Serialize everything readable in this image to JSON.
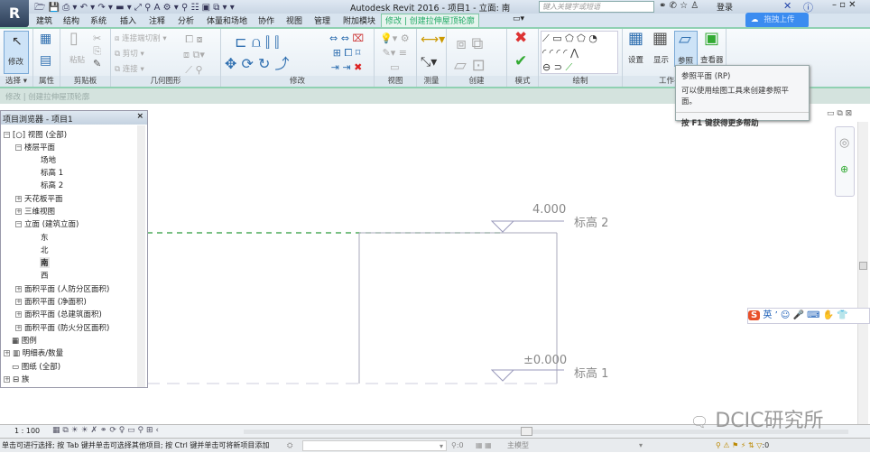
{
  "app": {
    "title": "Autodesk Revit 2016 -    项目1 - 立面: 南",
    "logo": "R",
    "search_placeholder": "键入关键字或短语",
    "login": "登录",
    "upload": "拖拽上传"
  },
  "tabs": [
    "建筑",
    "结构",
    "系统",
    "插入",
    "注释",
    "分析",
    "体量和场地",
    "协作",
    "视图",
    "管理",
    "附加模块",
    "修改 | 创建拉伸屋顶轮廓"
  ],
  "ribbon": {
    "modify_btn": "修改",
    "paste": "粘贴",
    "geometry": {
      "join_cut": "连接端切割",
      "cut": "剪切",
      "join": "连接"
    },
    "workplane": {
      "set": "设置",
      "show": "显示",
      "ref": "参照",
      "viewer": "查看器"
    },
    "panels": {
      "select": "选择",
      "properties": "属性",
      "clipboard": "剪贴板",
      "geometry": "几何图形",
      "modify": "修改",
      "view": "视图",
      "measure": "测量",
      "create": "创建",
      "mode": "模式",
      "draw": "绘制",
      "workplane": "工作平面"
    }
  },
  "context_bar": "修改 | 创建拉伸屋顶轮廓",
  "tooltip": {
    "title": "参照平面 (RP)",
    "desc": "可以使用绘图工具来创建参照平面。",
    "help": "按 F1 键获得更多帮助"
  },
  "browser": {
    "title": "项目浏览器 - 项目1",
    "items": [
      "视图 (全部)",
      "楼层平面",
      "场地",
      "标高 1",
      "标高 2",
      "天花板平面",
      "三维视图",
      "立面 (建筑立面)",
      "东",
      "北",
      "南",
      "西",
      "面积平面 (人防分区面积)",
      "面积平面 (净面积)",
      "面积平面 (总建筑面积)",
      "面积平面 (防火分区面积)",
      "图例",
      "明细表/数量",
      "图纸 (全部)",
      "族"
    ]
  },
  "drawing": {
    "level2_value": "4.000",
    "level2_name": "标高 2",
    "level1_value": "±0.000",
    "level1_name": "标高 1",
    "sketch_color": "#2a9a3a"
  },
  "view_bar": {
    "scale": "1 : 100"
  },
  "status": {
    "hint": "单击可进行选择; 按 Tab 键并单击可选择其他项目; 按 Ctrl 键并单击可将新项目添加",
    "zero": ":0",
    "model": "主模型",
    "filter": ":0"
  },
  "ime": {
    "lang": "英"
  },
  "watermark": "DCIC研究所"
}
